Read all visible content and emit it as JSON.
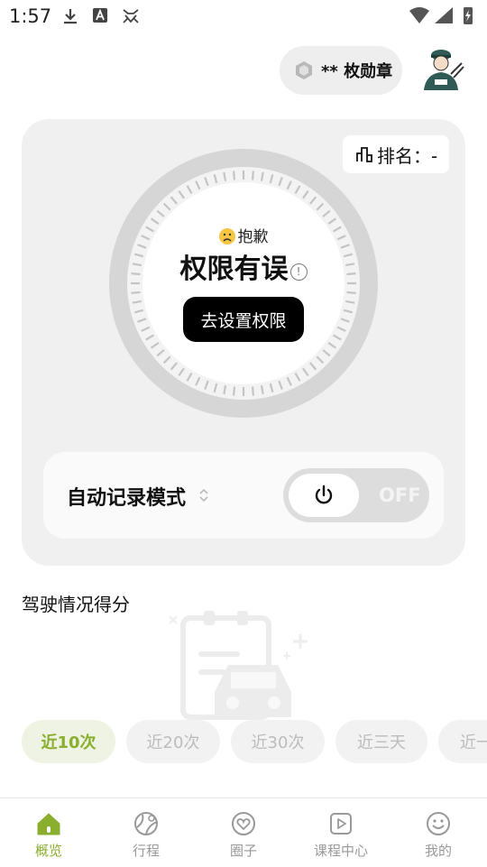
{
  "status_bar": {
    "time": "1:57",
    "icons_left": [
      "download-icon",
      "font-a-icon",
      "cat-icon"
    ],
    "icons_right": [
      "wifi-icon",
      "signal-icon",
      "battery-charging-icon"
    ]
  },
  "header": {
    "badge_label": "** 枚勋章",
    "badge_icon": "hexagon-medal-icon",
    "avatar_icon": "driver-avatar-icon"
  },
  "card": {
    "rank_label": "排名：-",
    "rank_icon": "ranking-icon",
    "apology_text": "抱歉",
    "permission_title": "权限有误",
    "info_glyph": "!",
    "setup_button": "去设置权限"
  },
  "mode": {
    "label": "自动记录模式",
    "toggle_state": "OFF"
  },
  "section": {
    "title": "驾驶情况得分"
  },
  "filters": [
    {
      "label": "近10次",
      "active": true
    },
    {
      "label": "近20次",
      "active": false
    },
    {
      "label": "近30次",
      "active": false
    },
    {
      "label": "近三天",
      "active": false
    },
    {
      "label": "近一",
      "active": false
    }
  ],
  "tabs": [
    {
      "label": "概览",
      "icon": "home-icon",
      "active": true
    },
    {
      "label": "行程",
      "icon": "globe-route-icon",
      "active": false
    },
    {
      "label": "圈子",
      "icon": "heart-circle-icon",
      "active": false
    },
    {
      "label": "课程中心",
      "icon": "play-video-icon",
      "active": false
    },
    {
      "label": "我的",
      "icon": "smiley-icon",
      "active": false
    }
  ],
  "colors": {
    "accent": "#8aae2e",
    "card_bg": "#f0f0f0",
    "button_bg": "#000000"
  }
}
